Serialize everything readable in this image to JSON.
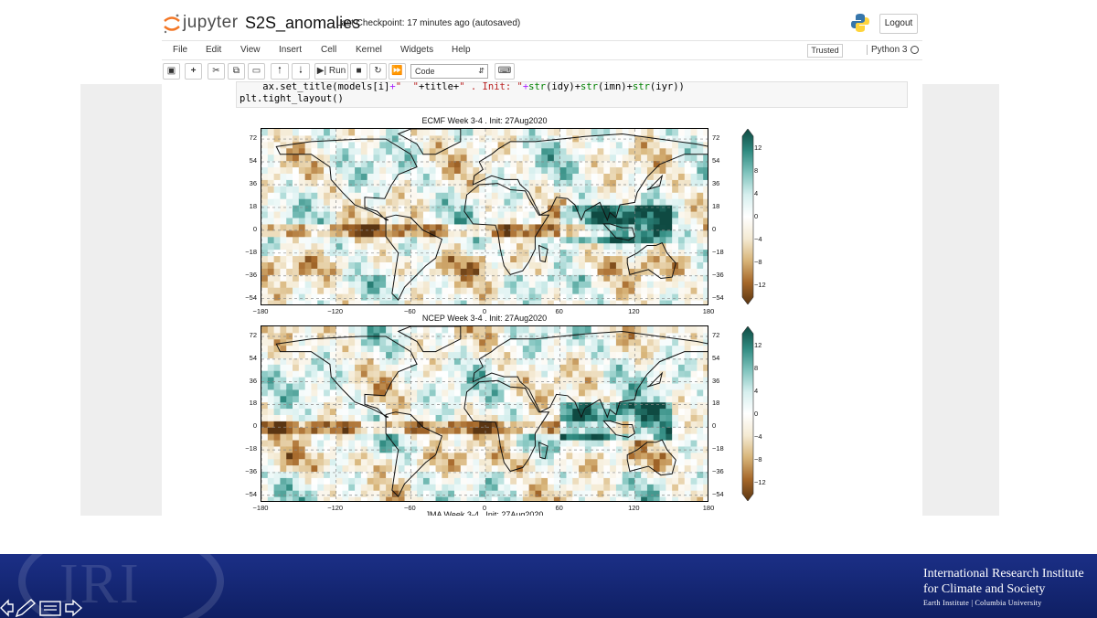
{
  "app": {
    "logo_text": "jupyter",
    "notebook_name": "S2S_anomalies",
    "checkpoint_text": "Last Checkpoint: 17 minutes ago  (autosaved)",
    "logout_label": "Logout"
  },
  "menu": [
    "File",
    "Edit",
    "View",
    "Insert",
    "Cell",
    "Kernel",
    "Widgets",
    "Help"
  ],
  "status": {
    "trusted_label": "Trusted",
    "kernel_label": "Python 3"
  },
  "toolbar": {
    "run_label": "Run",
    "cell_type_value": "Code",
    "icons": [
      "save-icon",
      "add-cell-icon",
      "cut-icon",
      "copy-icon",
      "paste-icon",
      "move-up-icon",
      "move-down-icon",
      "run-icon",
      "stop-icon",
      "restart-icon",
      "fast-forward-icon",
      "keyboard-icon"
    ]
  },
  "code": {
    "line1_a": "    ax.set_title(models[i]",
    "line1_b": "+",
    "line1_c": "\"  \"",
    "line1_d": "+title+",
    "line1_e": "\" . Init: \"",
    "line1_f": "+",
    "line1_g": "str",
    "line1_h": "(idy)+",
    "line1_i": "str",
    "line1_j": "(imn)+",
    "line1_k": "str",
    "line1_l": "(iyr))",
    "line2": "plt.tight_layout()"
  },
  "chart_data": [
    {
      "type": "heatmap",
      "title": "ECMF  Week 3-4 . Init: 27Aug2020",
      "x_ticks": [
        "−180",
        "−120",
        "−60",
        "0",
        "60",
        "120",
        "180"
      ],
      "y_ticks": [
        "72",
        "54",
        "36",
        "18",
        "0",
        "−18",
        "−36",
        "−54"
      ],
      "xlim": [
        -180,
        180
      ],
      "ylim": [
        -60,
        80
      ],
      "colorbar_ticks": [
        "12",
        "8",
        "4",
        "0",
        "−4",
        "−8",
        "−12"
      ],
      "colorbar_range": [
        -14,
        14
      ],
      "colormap": [
        "#5a3512",
        "#a6682a",
        "#d8b57a",
        "#f4ead3",
        "#ffffff",
        "#d6efee",
        "#7fc3bd",
        "#2f8a80",
        "#0f4a42"
      ],
      "grid": true
    },
    {
      "type": "heatmap",
      "title": "NCEP  Week 3-4 . Init: 27Aug2020",
      "x_ticks": [
        "−180",
        "−120",
        "−60",
        "0",
        "60",
        "120",
        "180"
      ],
      "y_ticks": [
        "72",
        "54",
        "36",
        "18",
        "0",
        "−18",
        "−36",
        "−54"
      ],
      "xlim": [
        -180,
        180
      ],
      "ylim": [
        -60,
        80
      ],
      "colorbar_ticks": [
        "12",
        "8",
        "4",
        "0",
        "−4",
        "−8",
        "−12"
      ],
      "colorbar_range": [
        -14,
        14
      ],
      "colormap": [
        "#5a3512",
        "#a6682a",
        "#d8b57a",
        "#f4ead3",
        "#ffffff",
        "#d6efee",
        "#7fc3bd",
        "#2f8a80",
        "#0f4a42"
      ],
      "grid": true
    }
  ],
  "next_title_partial": "JMA  Week 3-4 . Init: 27Aug2020",
  "footer": {
    "watermark": "IRI",
    "inst_line1": "International Research Institute",
    "inst_line2": "for Climate and Society",
    "inst_line3": "Earth Institute | Columbia University"
  }
}
